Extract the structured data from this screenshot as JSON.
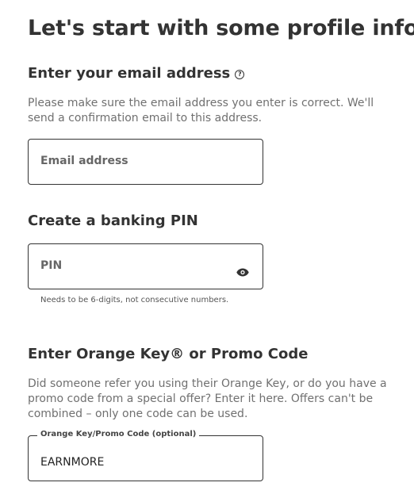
{
  "title": "Let's start with some profile info",
  "email_section": {
    "heading": "Enter your email address",
    "help_icon": "question-circle-icon",
    "description": "Please make sure the email address you enter is correct. We'll send a confirmation email to this address.",
    "placeholder": "Email address"
  },
  "pin_section": {
    "heading": "Create a banking PIN",
    "placeholder": "PIN",
    "toggle_icon": "eye-icon",
    "hint": "Needs to be 6-digits, not consecutive numbers."
  },
  "promo_section": {
    "heading": "Enter Orange Key® or Promo Code",
    "description": "Did someone refer you using their Orange Key, or do you have a promo code from a special offer? Enter it here. Offers can't be combined – only one code can be used.",
    "label": "Orange Key/Promo Code (optional)",
    "value": "EARNMORE"
  }
}
